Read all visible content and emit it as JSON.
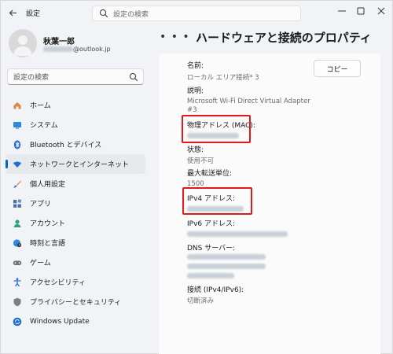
{
  "window": {
    "app_title": "設定",
    "search_placeholder": "設定の検索",
    "controls": [
      "minimize",
      "maximize",
      "close"
    ]
  },
  "profile": {
    "name": "秋葉一郎",
    "email_suffix": "@outlook.jp"
  },
  "sidebar": {
    "search_placeholder": "設定の検索",
    "items": [
      {
        "label": "ホーム",
        "icon": "home-icon"
      },
      {
        "label": "システム",
        "icon": "system-icon"
      },
      {
        "label": "Bluetooth とデバイス",
        "icon": "bluetooth-icon"
      },
      {
        "label": "ネットワークとインターネット",
        "icon": "wifi-icon",
        "active": true
      },
      {
        "label": "個人用設定",
        "icon": "brush-icon"
      },
      {
        "label": "アプリ",
        "icon": "apps-icon"
      },
      {
        "label": "アカウント",
        "icon": "account-icon"
      },
      {
        "label": "時刻と言語",
        "icon": "globe-clock-icon"
      },
      {
        "label": "ゲーム",
        "icon": "gamepad-icon"
      },
      {
        "label": "アクセシビリティ",
        "icon": "accessibility-icon"
      },
      {
        "label": "プライバシーとセキュリティ",
        "icon": "shield-icon"
      },
      {
        "label": "Windows Update",
        "icon": "update-icon"
      }
    ]
  },
  "main": {
    "breadcrumb_more": "• • •",
    "page_title": "ハードウェアと接続のプロパティ",
    "copy_button": "コピー",
    "properties": {
      "name_label": "名前:",
      "name_value": "ローカル エリア接続* 3",
      "description_label": "説明:",
      "description_value_1": "Microsoft Wi-Fi Direct Virtual Adapter",
      "description_value_2": "#3",
      "mac_label": "物理アドレス (MAC):",
      "status_label": "状態:",
      "status_value": "使用不可",
      "mtu_label": "最大転送単位:",
      "mtu_value": "1500",
      "ipv4_label": "IPv4 アドレス:",
      "ipv6_label": "IPv6 アドレス:",
      "dns_label": "DNS サーバー:",
      "connection_label": "接続 (IPv4/IPv6):",
      "connection_value": "切断済み"
    }
  },
  "colors": {
    "accent": "#0067c0",
    "highlight_box": "#e01a1a"
  }
}
